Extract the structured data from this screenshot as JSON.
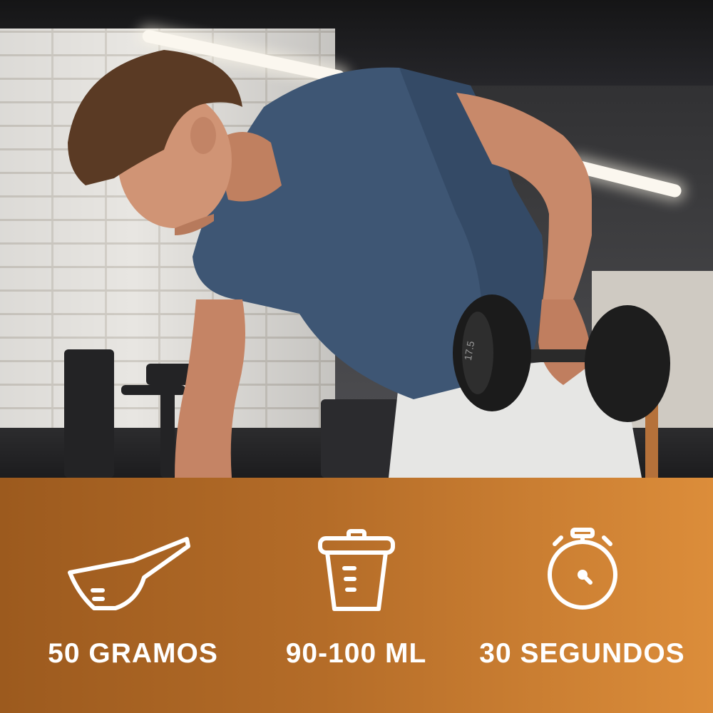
{
  "theme": {
    "bar_gradient_start": "#9c5a1e",
    "bar_gradient_end": "#dc8d3a",
    "icon_color": "#ffffff",
    "label_color": "#ffffff"
  },
  "photo": {
    "dumbbell_marking": "17.5"
  },
  "info": {
    "items": [
      {
        "icon": "scoop-icon",
        "label": "50 GRAMOS"
      },
      {
        "icon": "shaker-cup-icon",
        "label": "90-100 ML"
      },
      {
        "icon": "stopwatch-icon",
        "label": "30 SEGUNDOS"
      }
    ]
  }
}
